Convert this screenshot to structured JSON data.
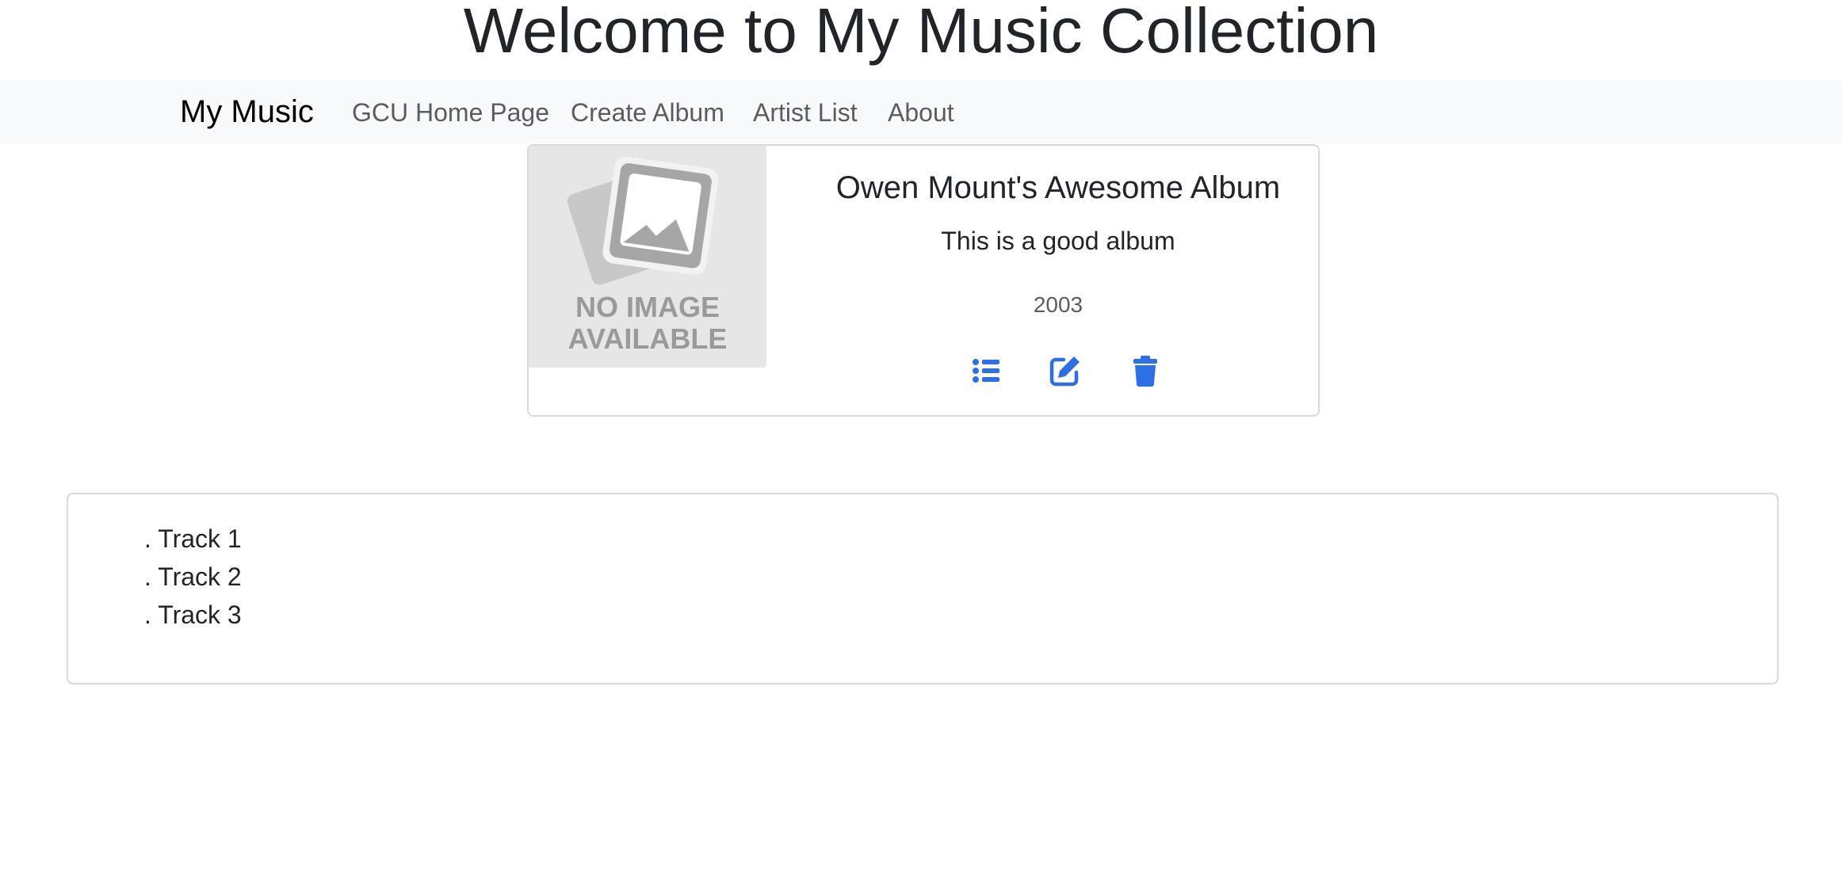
{
  "header": {
    "title": "Welcome to My Music Collection"
  },
  "navbar": {
    "brand": "My Music",
    "links": [
      {
        "label": "GCU Home Page"
      },
      {
        "label": "Create Album"
      },
      {
        "label": "Artist List"
      },
      {
        "label": "About"
      }
    ]
  },
  "album": {
    "image_placeholder": "NO IMAGE AVAILABLE",
    "image_placeholder_lines": [
      "NO IMAGE",
      "AVAILABLE"
    ],
    "title": "Owen Mount's Awesome Album",
    "description": "This is a good album",
    "year": "2003",
    "actions": [
      {
        "icon": "list-icon"
      },
      {
        "icon": "edit-icon"
      },
      {
        "icon": "trash-icon"
      }
    ],
    "accent_color": "#2f6fe6"
  },
  "tracks": [
    {
      "label": ". Track 1"
    },
    {
      "label": ". Track 2"
    },
    {
      "label": ". Track 3"
    }
  ]
}
